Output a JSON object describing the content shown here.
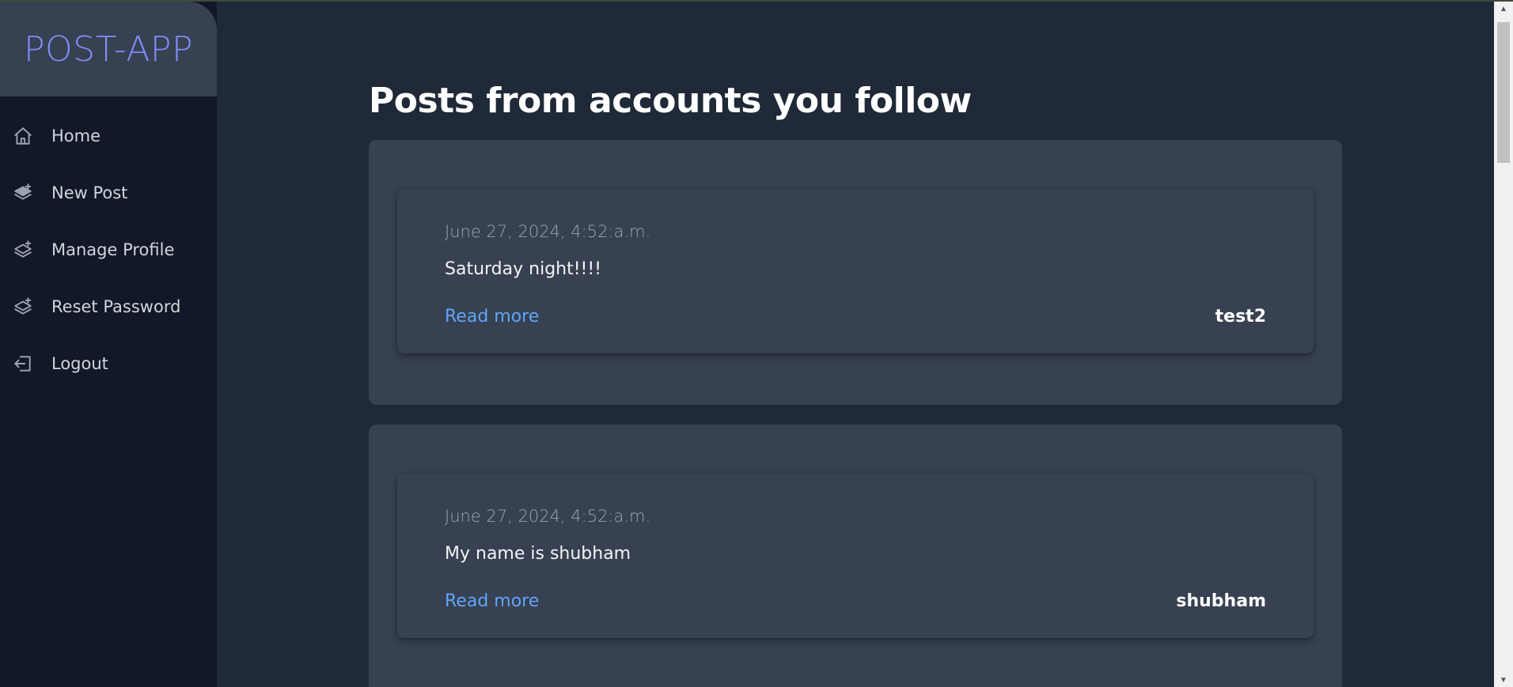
{
  "app": {
    "brand": "POST-APP"
  },
  "sidebar": {
    "items": [
      {
        "label": "Home",
        "icon": "home-icon"
      },
      {
        "label": "New Post",
        "icon": "layers-icon"
      },
      {
        "label": "Manage Profile",
        "icon": "layers-plus-icon"
      },
      {
        "label": "Reset Password",
        "icon": "layers-plus-icon"
      },
      {
        "label": "Logout",
        "icon": "logout-icon"
      }
    ]
  },
  "main": {
    "title": "Posts from accounts you follow",
    "posts": [
      {
        "date": "June 27, 2024, 4:52:a.m.",
        "body": "Saturday night!!!!",
        "read_more": "Read more",
        "author": "test2"
      },
      {
        "date": "June 27, 2024, 4:52:a.m.",
        "body": "My name is shubham",
        "read_more": "Read more",
        "author": "shubham"
      }
    ]
  },
  "colors": {
    "background": "#1f2937",
    "sidebar": "#111827",
    "brand_bg": "#374151",
    "brand_text": "#818cf8",
    "card": "#374151",
    "link": "#60a5fa"
  }
}
